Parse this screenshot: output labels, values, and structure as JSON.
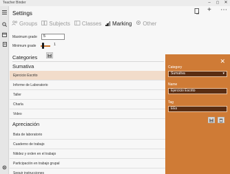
{
  "window": {
    "title": "Teacher Binder",
    "minimize_glyph": "–",
    "maximize_glyph": "▢",
    "close_glyph": "✕"
  },
  "rail": {
    "icons": [
      "hamburger-icon",
      "search-icon",
      "folder-icon",
      "document-icon",
      "gear-icon"
    ]
  },
  "header": {
    "title": "Settings",
    "bookmark_icon": "bookmark-icon",
    "add_glyph": "+",
    "more_glyph": "⋯"
  },
  "tabs": [
    {
      "label": "Groups",
      "icon": "groups-icon"
    },
    {
      "label": "Subjects",
      "icon": "subjects-icon"
    },
    {
      "label": "Classes",
      "icon": "classes-icon"
    },
    {
      "label": "Marking",
      "icon": "bar-chart-icon",
      "active": true
    },
    {
      "label": "Other",
      "icon": "gear-icon"
    }
  ],
  "grades": {
    "max_label": "Maximum grade",
    "max_value": "5",
    "min_label": "Minimum grade",
    "min_value": "1",
    "min_slider_fraction": 0.1
  },
  "categories_title": "Categories",
  "sections": [
    {
      "title": "Sumativa",
      "items": [
        "Ejercicio Escrito",
        "Informe de Laboratorio",
        "Taller",
        "Charla",
        "Video"
      ],
      "selected_index": 0
    },
    {
      "title": "Apreciación",
      "items": [
        "Bata de laboratorio",
        "Cuaderno de trabajo",
        "Nitidez y orden en el trabajo",
        "Participación en trabajo grupal",
        "Seguir instrucciones"
      ]
    }
  ],
  "panel": {
    "close_glyph": "✕",
    "category_label": "Category",
    "category_value": "Sumativa",
    "name_label": "Name",
    "name_value": "Ejercicio Escrito",
    "tag_label": "Tag",
    "tag_value": "EEs",
    "accent": "#cf7b36",
    "field_bg": "#5a2d12"
  },
  "colors": {
    "accent": "#c8722a",
    "selected_row": "#f2dcca"
  }
}
